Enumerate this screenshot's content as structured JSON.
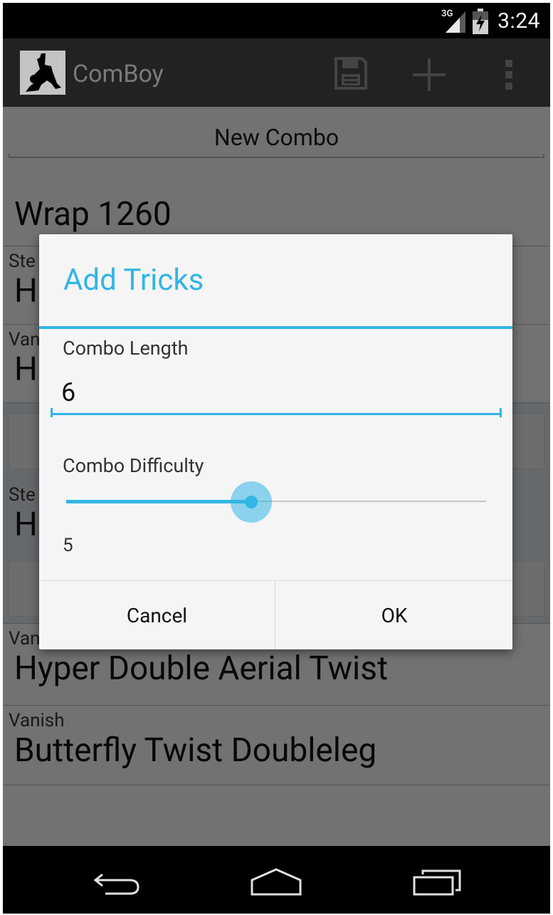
{
  "status_bar": {
    "network": "3G",
    "time": "3:24"
  },
  "action_bar": {
    "app_title": "ComBoy",
    "icons": [
      "app-logo",
      "save-icon",
      "add-icon",
      "overflow-menu-icon"
    ]
  },
  "content": {
    "combo_name": "New Combo",
    "combo_title": "Wrap 1260",
    "rows": [
      {
        "prefix": "Ste",
        "trick": "H"
      },
      {
        "prefix": "Van",
        "trick": "H"
      },
      {
        "prefix": "Ste",
        "trick": "H"
      },
      {
        "prefix": "Vanish",
        "trick": "Hyper Double Aerial Twist"
      },
      {
        "prefix": "Vanish",
        "trick": "Butterfly Twist Doubleleg"
      }
    ]
  },
  "dialog": {
    "title": "Add Tricks",
    "length_label": "Combo Length",
    "length_value": "6",
    "difficulty_label": "Combo Difficulty",
    "difficulty_value": "5",
    "difficulty_fraction": 0.44,
    "cancel_label": "Cancel",
    "ok_label": "OK"
  },
  "nav_bar": {
    "icons": [
      "back-icon",
      "home-icon",
      "recents-icon"
    ]
  },
  "colors": {
    "accent": "#33b5e5",
    "action_bar": "#222222",
    "dialog_bg": "#f5f5f5"
  }
}
